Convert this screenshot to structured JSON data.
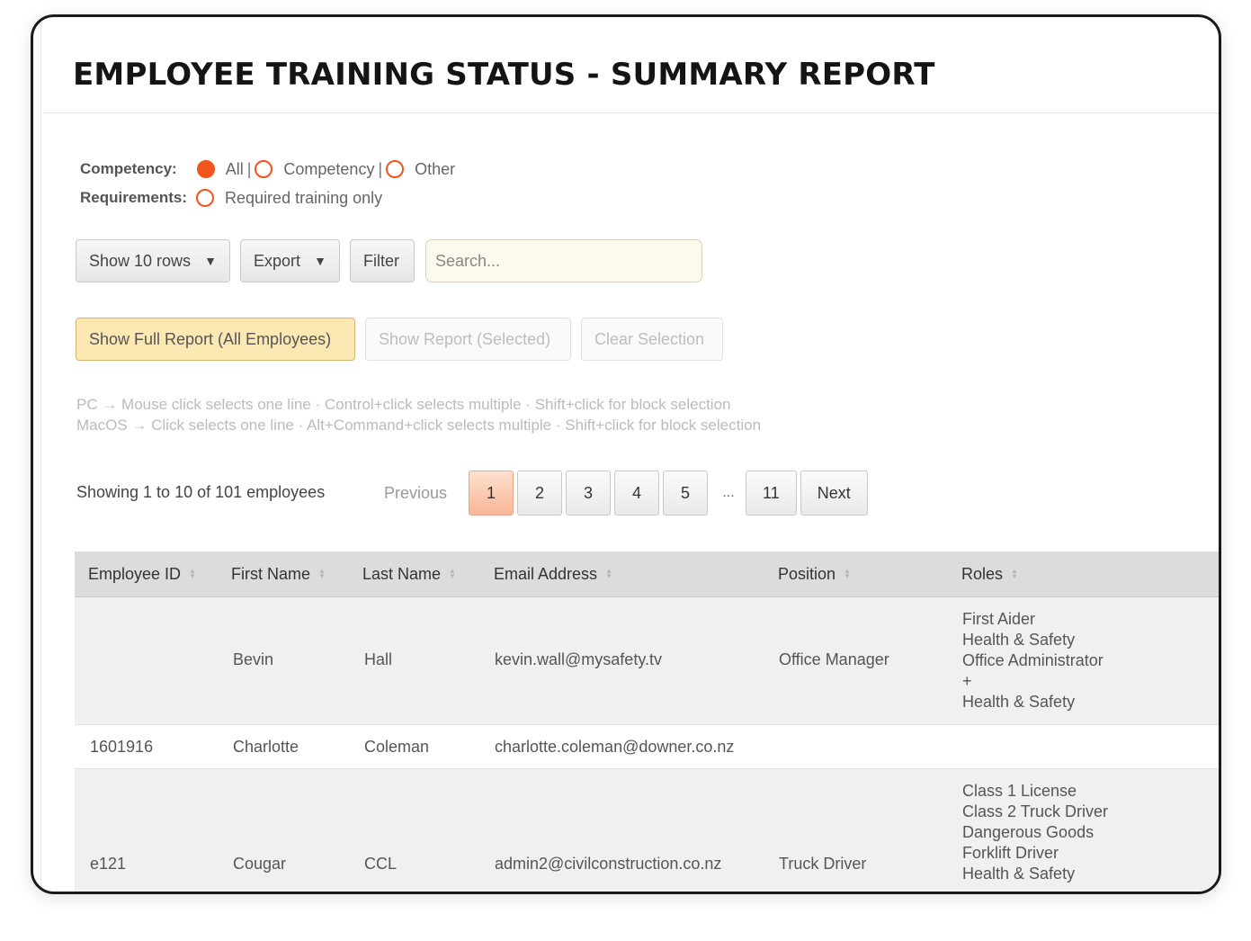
{
  "title": "EMPLOYEE TRAINING STATUS - SUMMARY REPORT",
  "filters": {
    "competency_label": "Competency:",
    "competency_options": [
      "All",
      "Competency",
      "Other"
    ],
    "competency_selected": "All",
    "separator": "|",
    "requirements_label": "Requirements:",
    "requirements_option": "Required training only"
  },
  "toolbar": {
    "rows_label": "Show 10 rows",
    "export_label": "Export",
    "filter_label": "Filter",
    "caret": "▼",
    "search_placeholder": "Search..."
  },
  "actions": {
    "full_report": "Show Full Report (All Employees)",
    "selected_report": "Show Report (Selected)",
    "clear_selection": "Clear Selection"
  },
  "hints": {
    "pc": "PC → Mouse click selects one line · Control+click selects multiple · Shift+click for block selection",
    "mac": "MacOS → Click selects one line · Alt+Command+click selects multiple · Shift+click for block selection"
  },
  "pagination": {
    "info": "Showing 1 to 10 of 101 employees",
    "previous": "Previous",
    "pages": [
      "1",
      "2",
      "3",
      "4",
      "5"
    ],
    "ellipsis": "...",
    "last": "11",
    "next": "Next",
    "current": "1"
  },
  "table": {
    "columns": [
      "Employee ID",
      "First Name",
      "Last Name",
      "Email Address",
      "Position",
      "Roles"
    ],
    "rows": [
      {
        "id": "",
        "first": "Bevin",
        "last": "Hall",
        "email": "kevin.wall@mysafety.tv",
        "position": "Office Manager",
        "roles": [
          "First Aider",
          "Health & Safety",
          "Office Administrator",
          "+",
          "Health & Safety"
        ]
      },
      {
        "id": "1601916",
        "first": "Charlotte",
        "last": "Coleman",
        "email": "charlotte.coleman@downer.co.nz",
        "position": "",
        "roles": []
      },
      {
        "id": "e121",
        "first": "Cougar",
        "last": "CCL",
        "email": "admin2@civilconstruction.co.nz",
        "position": "Truck Driver",
        "roles": [
          "Class 1 License",
          "Class 2 Truck Driver",
          "Dangerous Goods",
          "Forklift Driver",
          "Health & Safety"
        ]
      }
    ]
  },
  "colors": {
    "accent": "#f2541b",
    "primary_button": "#fce8b3",
    "active_page": "#f9b596",
    "header_bg": "#dcdcdc"
  }
}
